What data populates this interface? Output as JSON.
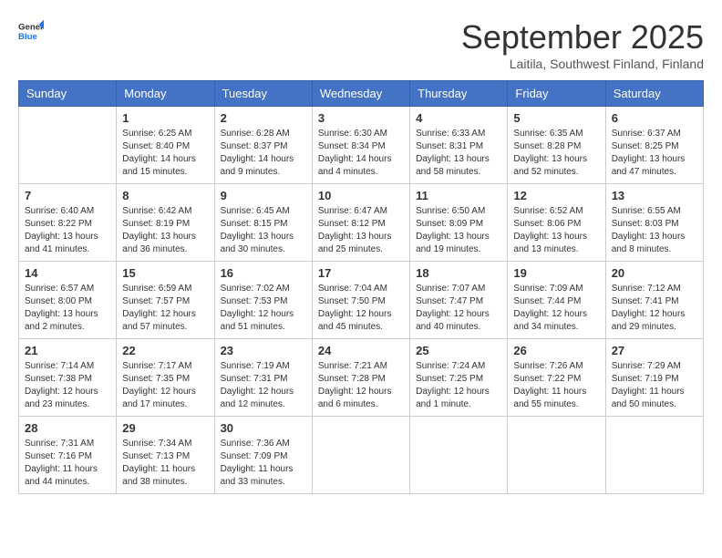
{
  "header": {
    "logo_general": "General",
    "logo_blue": "Blue",
    "month_title": "September 2025",
    "subtitle": "Laitila, Southwest Finland, Finland"
  },
  "days_of_week": [
    "Sunday",
    "Monday",
    "Tuesday",
    "Wednesday",
    "Thursday",
    "Friday",
    "Saturday"
  ],
  "weeks": [
    [
      {
        "day": "",
        "content": ""
      },
      {
        "day": "1",
        "content": "Sunrise: 6:25 AM\nSunset: 8:40 PM\nDaylight: 14 hours\nand 15 minutes."
      },
      {
        "day": "2",
        "content": "Sunrise: 6:28 AM\nSunset: 8:37 PM\nDaylight: 14 hours\nand 9 minutes."
      },
      {
        "day": "3",
        "content": "Sunrise: 6:30 AM\nSunset: 8:34 PM\nDaylight: 14 hours\nand 4 minutes."
      },
      {
        "day": "4",
        "content": "Sunrise: 6:33 AM\nSunset: 8:31 PM\nDaylight: 13 hours\nand 58 minutes."
      },
      {
        "day": "5",
        "content": "Sunrise: 6:35 AM\nSunset: 8:28 PM\nDaylight: 13 hours\nand 52 minutes."
      },
      {
        "day": "6",
        "content": "Sunrise: 6:37 AM\nSunset: 8:25 PM\nDaylight: 13 hours\nand 47 minutes."
      }
    ],
    [
      {
        "day": "7",
        "content": "Sunrise: 6:40 AM\nSunset: 8:22 PM\nDaylight: 13 hours\nand 41 minutes."
      },
      {
        "day": "8",
        "content": "Sunrise: 6:42 AM\nSunset: 8:19 PM\nDaylight: 13 hours\nand 36 minutes."
      },
      {
        "day": "9",
        "content": "Sunrise: 6:45 AM\nSunset: 8:15 PM\nDaylight: 13 hours\nand 30 minutes."
      },
      {
        "day": "10",
        "content": "Sunrise: 6:47 AM\nSunset: 8:12 PM\nDaylight: 13 hours\nand 25 minutes."
      },
      {
        "day": "11",
        "content": "Sunrise: 6:50 AM\nSunset: 8:09 PM\nDaylight: 13 hours\nand 19 minutes."
      },
      {
        "day": "12",
        "content": "Sunrise: 6:52 AM\nSunset: 8:06 PM\nDaylight: 13 hours\nand 13 minutes."
      },
      {
        "day": "13",
        "content": "Sunrise: 6:55 AM\nSunset: 8:03 PM\nDaylight: 13 hours\nand 8 minutes."
      }
    ],
    [
      {
        "day": "14",
        "content": "Sunrise: 6:57 AM\nSunset: 8:00 PM\nDaylight: 13 hours\nand 2 minutes."
      },
      {
        "day": "15",
        "content": "Sunrise: 6:59 AM\nSunset: 7:57 PM\nDaylight: 12 hours\nand 57 minutes."
      },
      {
        "day": "16",
        "content": "Sunrise: 7:02 AM\nSunset: 7:53 PM\nDaylight: 12 hours\nand 51 minutes."
      },
      {
        "day": "17",
        "content": "Sunrise: 7:04 AM\nSunset: 7:50 PM\nDaylight: 12 hours\nand 45 minutes."
      },
      {
        "day": "18",
        "content": "Sunrise: 7:07 AM\nSunset: 7:47 PM\nDaylight: 12 hours\nand 40 minutes."
      },
      {
        "day": "19",
        "content": "Sunrise: 7:09 AM\nSunset: 7:44 PM\nDaylight: 12 hours\nand 34 minutes."
      },
      {
        "day": "20",
        "content": "Sunrise: 7:12 AM\nSunset: 7:41 PM\nDaylight: 12 hours\nand 29 minutes."
      }
    ],
    [
      {
        "day": "21",
        "content": "Sunrise: 7:14 AM\nSunset: 7:38 PM\nDaylight: 12 hours\nand 23 minutes."
      },
      {
        "day": "22",
        "content": "Sunrise: 7:17 AM\nSunset: 7:35 PM\nDaylight: 12 hours\nand 17 minutes."
      },
      {
        "day": "23",
        "content": "Sunrise: 7:19 AM\nSunset: 7:31 PM\nDaylight: 12 hours\nand 12 minutes."
      },
      {
        "day": "24",
        "content": "Sunrise: 7:21 AM\nSunset: 7:28 PM\nDaylight: 12 hours\nand 6 minutes."
      },
      {
        "day": "25",
        "content": "Sunrise: 7:24 AM\nSunset: 7:25 PM\nDaylight: 12 hours\nand 1 minute."
      },
      {
        "day": "26",
        "content": "Sunrise: 7:26 AM\nSunset: 7:22 PM\nDaylight: 11 hours\nand 55 minutes."
      },
      {
        "day": "27",
        "content": "Sunrise: 7:29 AM\nSunset: 7:19 PM\nDaylight: 11 hours\nand 50 minutes."
      }
    ],
    [
      {
        "day": "28",
        "content": "Sunrise: 7:31 AM\nSunset: 7:16 PM\nDaylight: 11 hours\nand 44 minutes."
      },
      {
        "day": "29",
        "content": "Sunrise: 7:34 AM\nSunset: 7:13 PM\nDaylight: 11 hours\nand 38 minutes."
      },
      {
        "day": "30",
        "content": "Sunrise: 7:36 AM\nSunset: 7:09 PM\nDaylight: 11 hours\nand 33 minutes."
      },
      {
        "day": "",
        "content": ""
      },
      {
        "day": "",
        "content": ""
      },
      {
        "day": "",
        "content": ""
      },
      {
        "day": "",
        "content": ""
      }
    ]
  ]
}
